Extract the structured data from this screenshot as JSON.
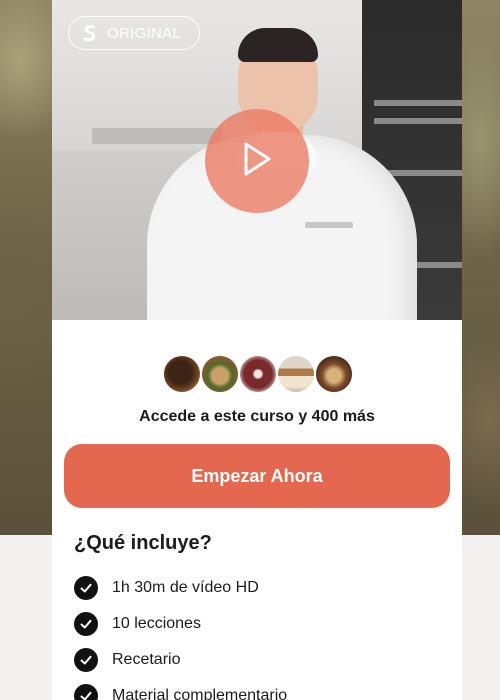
{
  "video": {
    "badge_label": "ORIGINAL",
    "badge_icon": "brand-s-logo-icon",
    "play_icon": "play-icon",
    "play_color": "#ec7862"
  },
  "course": {
    "avatars": [
      {
        "icon": "food-thumbnail-icon",
        "color": "#6b3a1e"
      },
      {
        "icon": "food-thumbnail-icon",
        "color": "#8a5a2b"
      },
      {
        "icon": "food-thumbnail-icon",
        "color": "#7a2a2a"
      },
      {
        "icon": "food-thumbnail-icon",
        "color": "#b07a48"
      },
      {
        "icon": "food-thumbnail-icon",
        "color": "#7b4a2a"
      }
    ],
    "access_text": "Accede a este curso y 400 más",
    "cta_label": "Empezar Ahora",
    "accent_color": "#e3684f"
  },
  "includes": {
    "title": "¿Qué incluye?",
    "items": [
      {
        "label": "1h 30m de vídeo HD",
        "icon": "check-circle-icon"
      },
      {
        "label": "10 lecciones",
        "icon": "check-circle-icon"
      },
      {
        "label": "Recetario",
        "icon": "check-circle-icon"
      },
      {
        "label": "Material complementario",
        "icon": "check-circle-icon"
      }
    ]
  }
}
